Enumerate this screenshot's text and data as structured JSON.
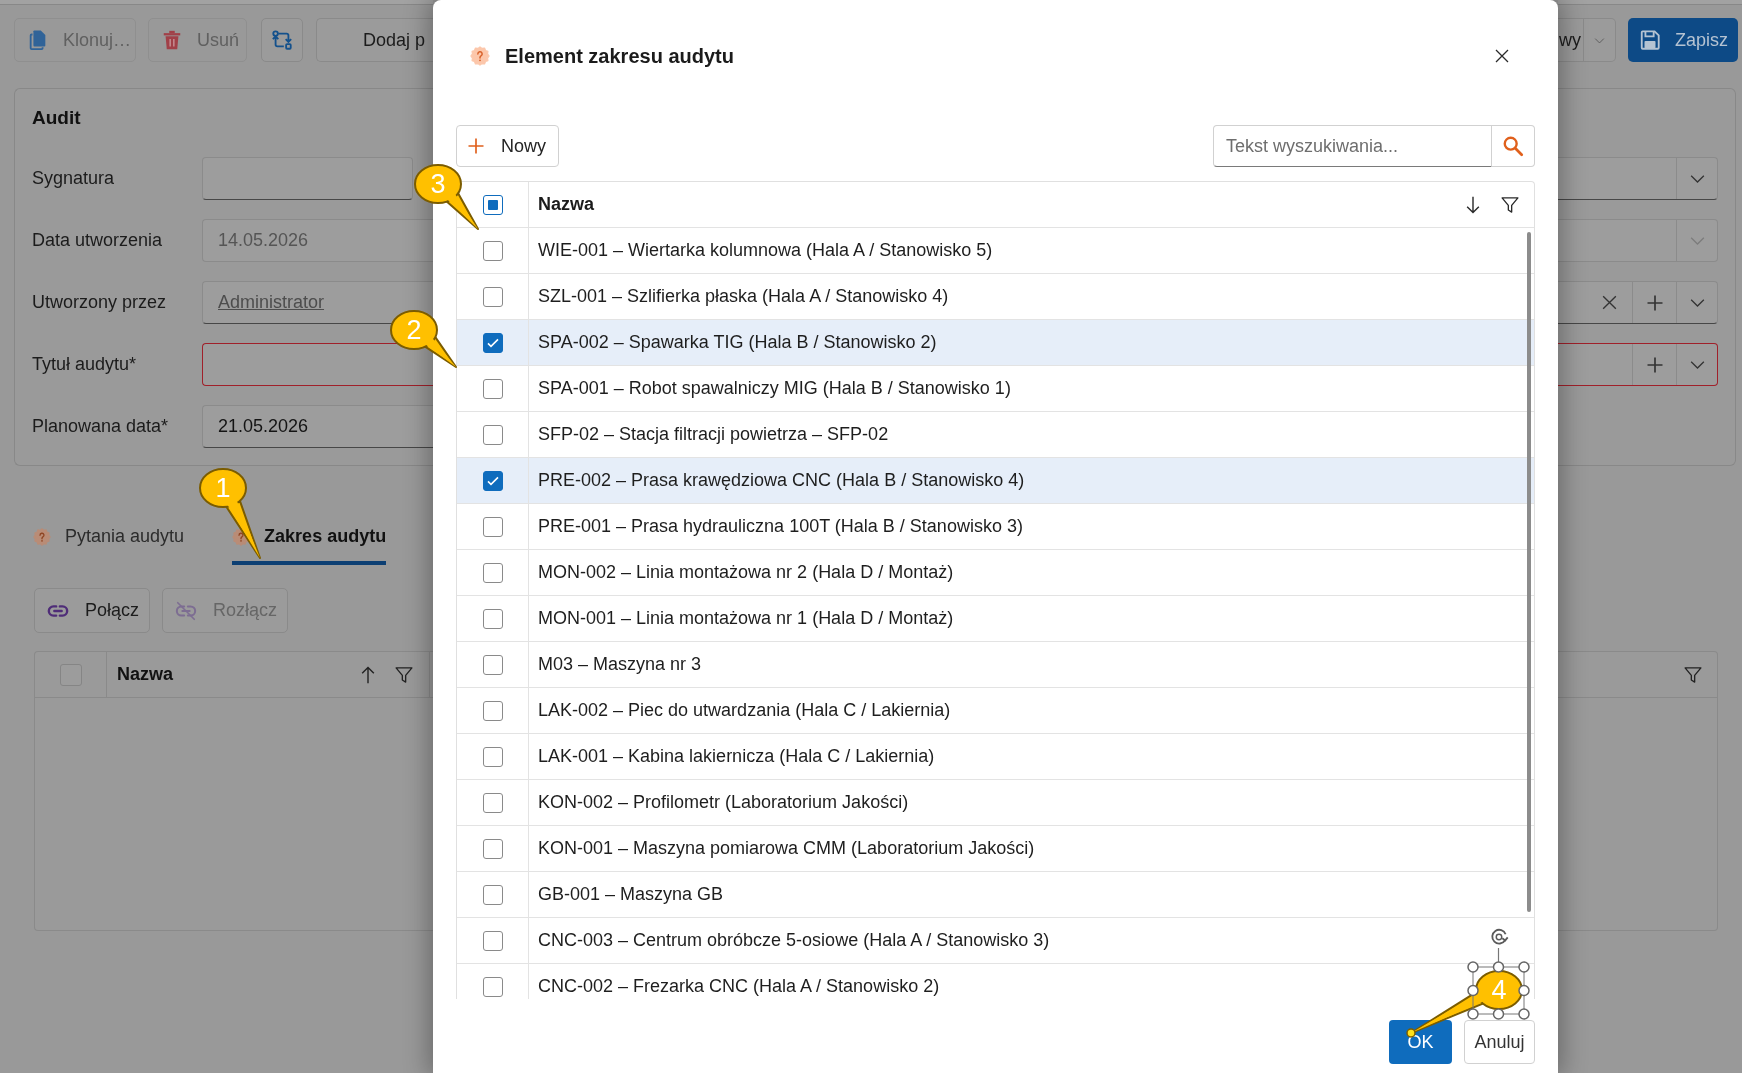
{
  "toolbar": {
    "buttons": [
      {
        "kind": "copy",
        "label": "Klonuj…",
        "disabled": true
      },
      {
        "kind": "delete",
        "label": "Usuń",
        "disabled": true
      },
      {
        "kind": "workflow",
        "disabled": false
      },
      {
        "kind": "text",
        "label": "Dodaj p",
        "disabled": false
      }
    ],
    "split_button": {
      "label": "wy"
    },
    "save_button": {
      "label": "Zapisz"
    }
  },
  "audit_panel": {
    "title": "Audit",
    "fields": [
      {
        "label": "Sygnatura",
        "kind": "dropdown",
        "disabled": false,
        "invalid": false
      },
      {
        "label": "Data utworzenia",
        "kind": "dropdown",
        "value": "14.05.2026",
        "disabled": true,
        "invalid": false
      },
      {
        "label": "Utworzony przez",
        "kind": "lookup",
        "value": "Administrator",
        "disabled": false,
        "invalid": false
      },
      {
        "label": "Tytuł audytu*",
        "kind": "lookup",
        "disabled": false,
        "invalid": true
      },
      {
        "label": "Planowana data*",
        "kind": "date",
        "value": "21.05.2026",
        "disabled": false,
        "invalid": false
      }
    ]
  },
  "tabs": [
    {
      "label": "Pytania audytu",
      "selected": false
    },
    {
      "label": "Zakres audytu",
      "selected": true
    }
  ],
  "scope_actions": [
    {
      "kind": "link",
      "label": "Połącz",
      "disabled": false
    },
    {
      "kind": "unlink",
      "label": "Rozłącz",
      "disabled": true
    }
  ],
  "scope_table": {
    "select_all": {
      "checked": false
    },
    "columns": [
      {
        "label": "Nazwa",
        "sort_ascending": true
      }
    ]
  },
  "dialog": {
    "title": "Element zakresu audytu",
    "new_button": {
      "label": "Nowy"
    },
    "search": {
      "placeholder": "Tekst wyszukiwania..."
    },
    "table": {
      "select_all": {
        "partial": true
      },
      "columns": [
        {
          "label": "Nazwa",
          "sort_ascending": false
        }
      ],
      "rows": [
        {
          "name": "WIE-001 – Wiertarka kolumnowa (Hala A / Stanowisko 5)",
          "selected": false
        },
        {
          "name": "SZL-001 – Szlifierka płaska (Hala A / Stanowisko 4)",
          "selected": false
        },
        {
          "name": "SPA-002 – Spawarka TIG (Hala B / Stanowisko 2)",
          "selected": true
        },
        {
          "name": "SPA-001 – Robot spawalniczy MIG (Hala B / Stanowisko 1)",
          "selected": false
        },
        {
          "name": "SFP-02 – Stacja filtracji powietrza – SFP-02",
          "selected": false
        },
        {
          "name": "PRE-002 – Prasa krawędziowa CNC (Hala B / Stanowisko 4)",
          "selected": true
        },
        {
          "name": "PRE-001 – Prasa hydrauliczna 100T (Hala B / Stanowisko 3)",
          "selected": false
        },
        {
          "name": "MON-002 – Linia montażowa nr 2 (Hala D / Montaż)",
          "selected": false
        },
        {
          "name": "MON-001 – Linia montażowa nr 1 (Hala D / Montaż)",
          "selected": false
        },
        {
          "name": "M03 – Maszyna nr 3",
          "selected": false
        },
        {
          "name": "LAK-002 – Piec do utwardzania (Hala C / Lakiernia)",
          "selected": false
        },
        {
          "name": "LAK-001 – Kabina lakiernicza (Hala C / Lakiernia)",
          "selected": false
        },
        {
          "name": "KON-002 – Profilometr (Laboratorium Jakości)",
          "selected": false
        },
        {
          "name": "KON-001 – Maszyna pomiarowa CMM (Laboratorium Jakości)",
          "selected": false
        },
        {
          "name": "GB-001 – Maszyna GB",
          "selected": false
        },
        {
          "name": "CNC-003 – Centrum obróbcze 5-osiowe (Hala A / Stanowisko 3)",
          "selected": false
        },
        {
          "name": "CNC-002 – Frezarka CNC (Hala A / Stanowisko 2)",
          "selected": false
        }
      ]
    },
    "buttons": [
      {
        "kind": "primary",
        "label": "OK"
      },
      {
        "kind": "secondary",
        "label": "Anuluj"
      }
    ]
  },
  "callouts": [
    {
      "label": "1",
      "selected": false
    },
    {
      "label": "2",
      "selected": false
    },
    {
      "label": "3",
      "selected": false
    },
    {
      "label": "4",
      "selected": true
    }
  ]
}
